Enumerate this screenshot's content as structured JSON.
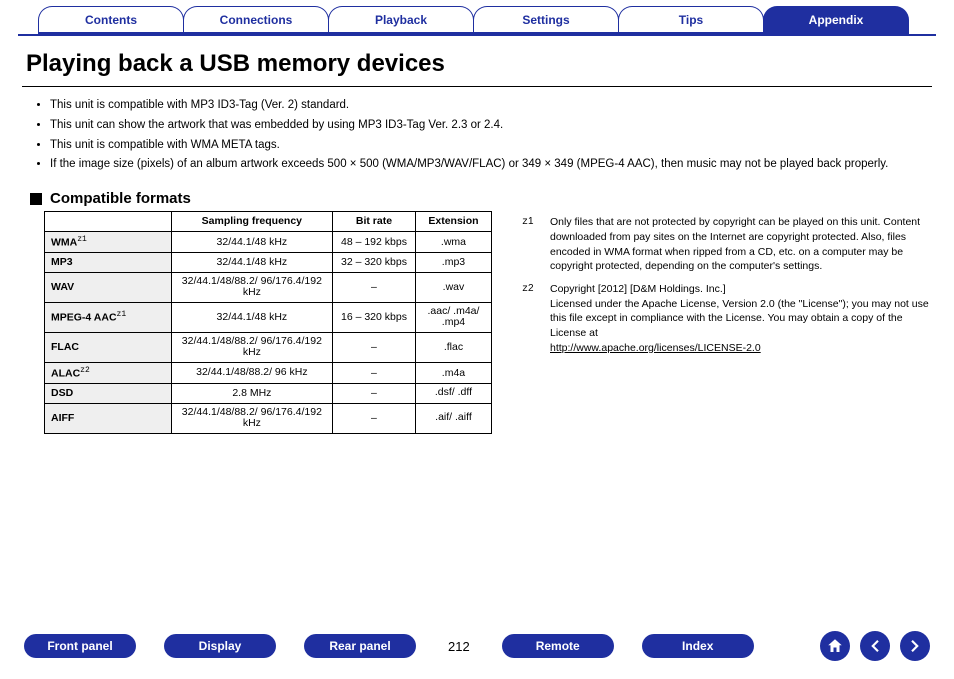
{
  "tabs": [
    {
      "label": "Contents",
      "active": false
    },
    {
      "label": "Connections",
      "active": false
    },
    {
      "label": "Playback",
      "active": false
    },
    {
      "label": "Settings",
      "active": false
    },
    {
      "label": "Tips",
      "active": false
    },
    {
      "label": "Appendix",
      "active": true
    }
  ],
  "title": "Playing back a USB memory devices",
  "bullets": [
    "This unit is compatible with MP3 ID3-Tag (Ver. 2) standard.",
    "This unit can show the artwork that was embedded by using MP3 ID3-Tag Ver. 2.3 or 2.4.",
    "This unit is compatible with WMA META tags.",
    "If the image size (pixels) of an album artwork exceeds 500 × 500 (WMA/MP3/WAV/FLAC) or 349 × 349 (MPEG-4 AAC), then music may not be played back properly."
  ],
  "section_label": "Compatible formats",
  "table": {
    "headers": [
      "Sampling frequency",
      "Bit rate",
      "Extension"
    ],
    "rows": [
      {
        "name": "WMA",
        "sup": "z1",
        "freq": "32/44.1/48 kHz",
        "rate": "48 – 192 kbps",
        "ext": ".wma"
      },
      {
        "name": "MP3",
        "sup": "",
        "freq": "32/44.1/48 kHz",
        "rate": "32 – 320 kbps",
        "ext": ".mp3"
      },
      {
        "name": "WAV",
        "sup": "",
        "freq": "32/44.1/48/88.2/ 96/176.4/192 kHz",
        "rate": "–",
        "ext": ".wav"
      },
      {
        "name": "MPEG-4 AAC",
        "sup": "z1",
        "freq": "32/44.1/48 kHz",
        "rate": "16 – 320 kbps",
        "ext": ".aac/ .m4a/ .mp4"
      },
      {
        "name": "FLAC",
        "sup": "",
        "freq": "32/44.1/48/88.2/ 96/176.4/192 kHz",
        "rate": "–",
        "ext": ".flac"
      },
      {
        "name": "ALAC",
        "sup": "z2",
        "freq": "32/44.1/48/88.2/ 96 kHz",
        "rate": "–",
        "ext": ".m4a"
      },
      {
        "name": "DSD",
        "sup": "",
        "freq": "2.8 MHz",
        "rate": "–",
        "ext": ".dsf/ .dff"
      },
      {
        "name": "AIFF",
        "sup": "",
        "freq": "32/44.1/48/88.2/ 96/176.4/192 kHz",
        "rate": "–",
        "ext": ".aif/ .aiff"
      }
    ]
  },
  "notes": [
    {
      "mark": "z1",
      "text": "Only files that are not protected by copyright can be played on this unit. Content downloaded from pay sites on the Internet are copyright protected. Also, files encoded in WMA format when ripped from a CD, etc. on a computer may be copyright protected, depending on the computer's settings."
    },
    {
      "mark": "z2",
      "text": "Copyright [2012] [D&M Holdings. Inc.]\nLicensed under the Apache License, Version 2.0 (the \"License\"); you may not use this file except in compliance with the License. You may obtain a copy of the License at",
      "link": "http://www.apache.org/licenses/LICENSE-2.0"
    }
  ],
  "footer": {
    "buttons": [
      "Front panel",
      "Display",
      "Rear panel"
    ],
    "page": "212",
    "buttons2": [
      "Remote",
      "Index"
    ]
  }
}
